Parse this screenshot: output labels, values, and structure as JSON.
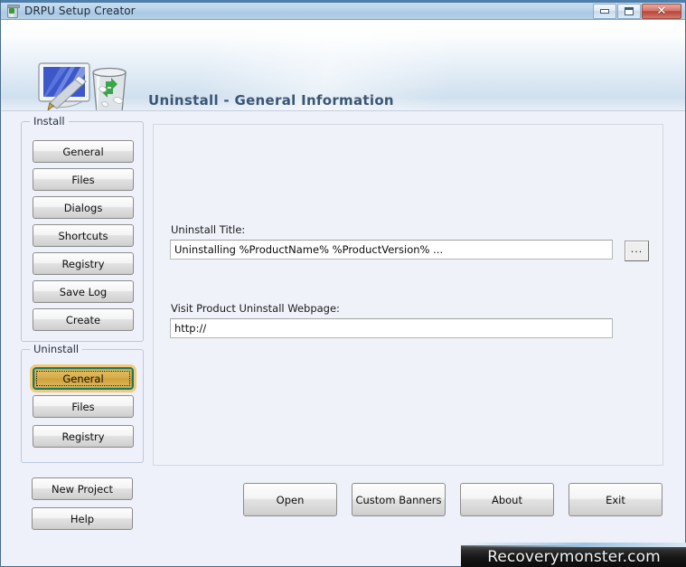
{
  "window": {
    "title": "DRPU Setup Creator",
    "icon": "recycle-bin-icon",
    "controls": {
      "minimize": "minimize-icon",
      "maximize": "maximize-icon",
      "close": "✕"
    }
  },
  "banner": {
    "title": "Uninstall - General Information",
    "icon": "monitor-pen-recyclebin-icon",
    "title_color": "#3b5674"
  },
  "sidebar": {
    "install": {
      "legend": "Install",
      "items": [
        {
          "label": "General",
          "selected": false
        },
        {
          "label": "Files",
          "selected": false
        },
        {
          "label": "Dialogs",
          "selected": false
        },
        {
          "label": "Shortcuts",
          "selected": false
        },
        {
          "label": "Registry",
          "selected": false
        },
        {
          "label": "Save Log",
          "selected": false
        },
        {
          "label": "Create",
          "selected": false
        }
      ]
    },
    "uninstall": {
      "legend": "Uninstall",
      "items": [
        {
          "label": "General",
          "selected": true
        },
        {
          "label": "Files",
          "selected": false
        },
        {
          "label": "Registry",
          "selected": false
        }
      ]
    },
    "lower": [
      {
        "label": "New Project"
      },
      {
        "label": "Help"
      }
    ],
    "selected_colors": {
      "fill": "#d9b04e",
      "border": "#1e7a5a",
      "glow": "#f2c97a"
    }
  },
  "main": {
    "uninstall_title": {
      "label": "Uninstall Title:",
      "value": "Uninstalling %ProductName% %ProductVersion% ...",
      "placeholder": ""
    },
    "browse_button": {
      "label": "..."
    },
    "webpage": {
      "label": "Visit Product Uninstall Webpage:",
      "value": "http://",
      "placeholder": ""
    }
  },
  "actions": [
    {
      "label": "Open"
    },
    {
      "label": "Custom Banners"
    },
    {
      "label": "About"
    },
    {
      "label": "Exit"
    }
  ],
  "watermark": {
    "text": "Recoverymonster.com"
  }
}
